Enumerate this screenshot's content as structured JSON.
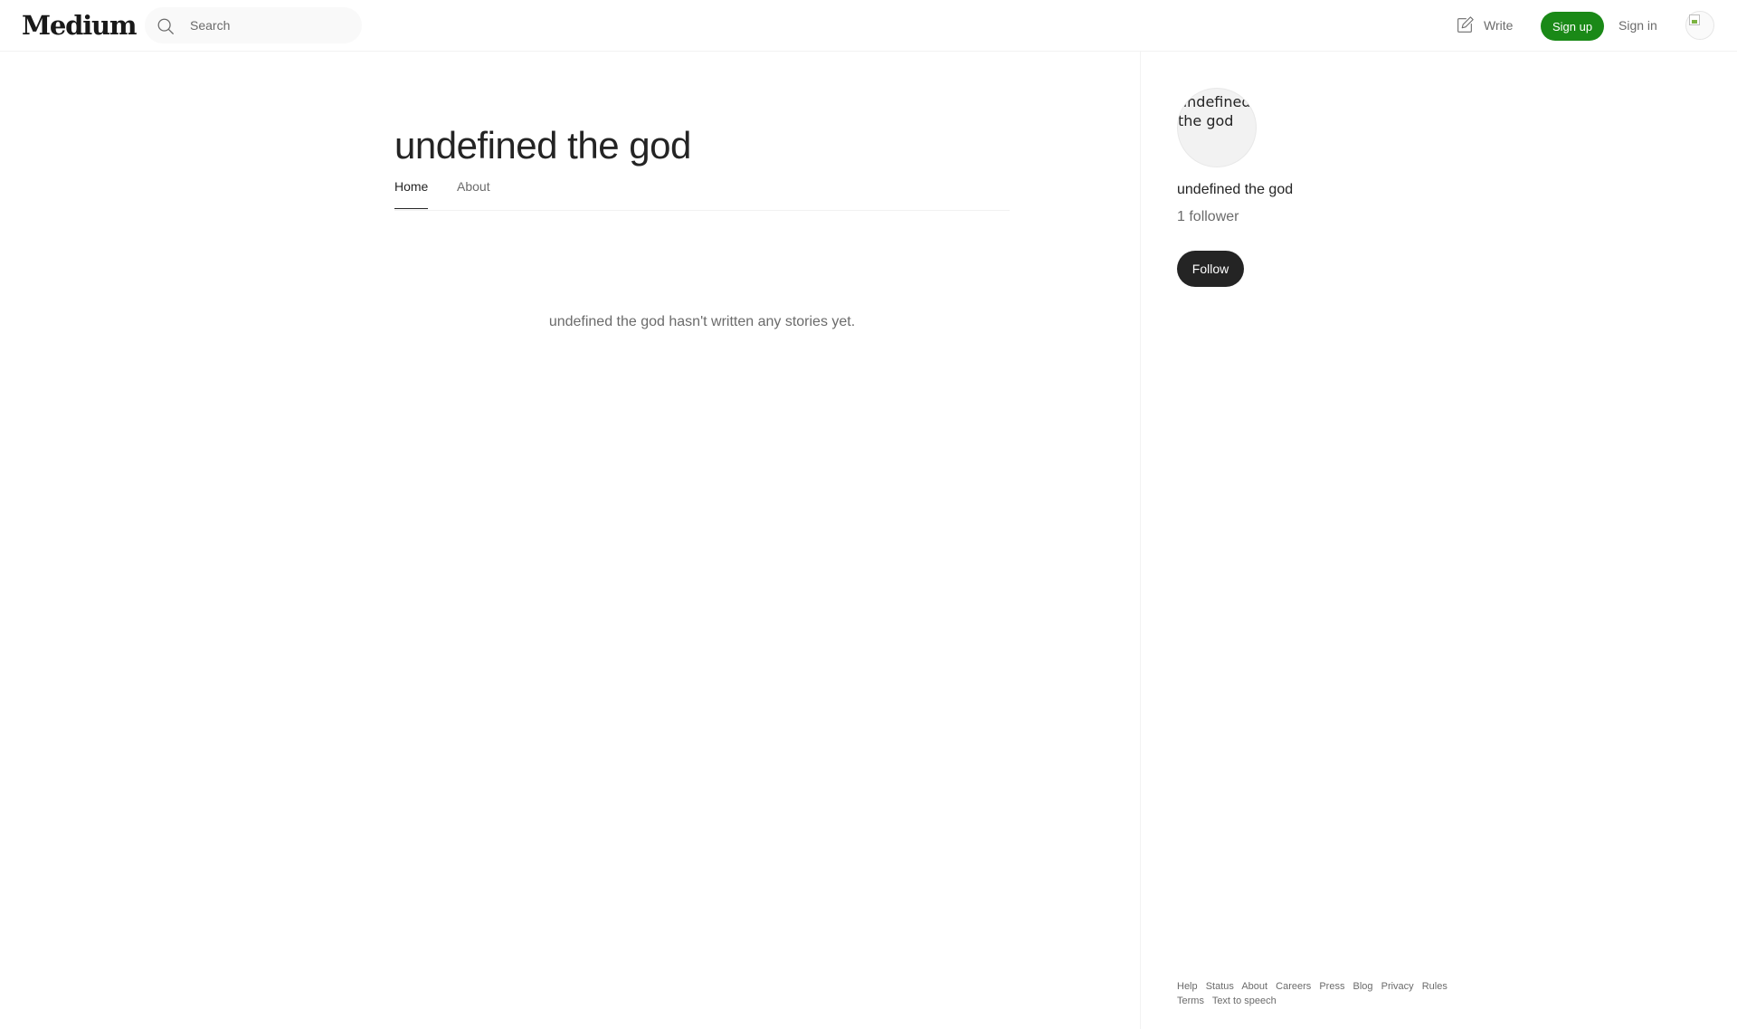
{
  "header": {
    "logo": "Medium",
    "search_placeholder": "Search",
    "write_label": "Write",
    "signup_label": "Sign up",
    "signin_label": "Sign in",
    "accent_color": "#1a8917"
  },
  "profile": {
    "title": "undefined the god",
    "tabs": [
      {
        "label": "Home",
        "active": true
      },
      {
        "label": "About",
        "active": false
      }
    ],
    "empty_message": "undefined the god hasn't written any stories yet."
  },
  "sidebar": {
    "avatar_alt": "undefined the god",
    "name": "undefined the god",
    "followers": "1 follower",
    "follow_label": "Follow"
  },
  "footer": {
    "links": [
      "Help",
      "Status",
      "About",
      "Careers",
      "Press",
      "Blog",
      "Privacy",
      "Rules",
      "Terms",
      "Text to speech"
    ]
  }
}
